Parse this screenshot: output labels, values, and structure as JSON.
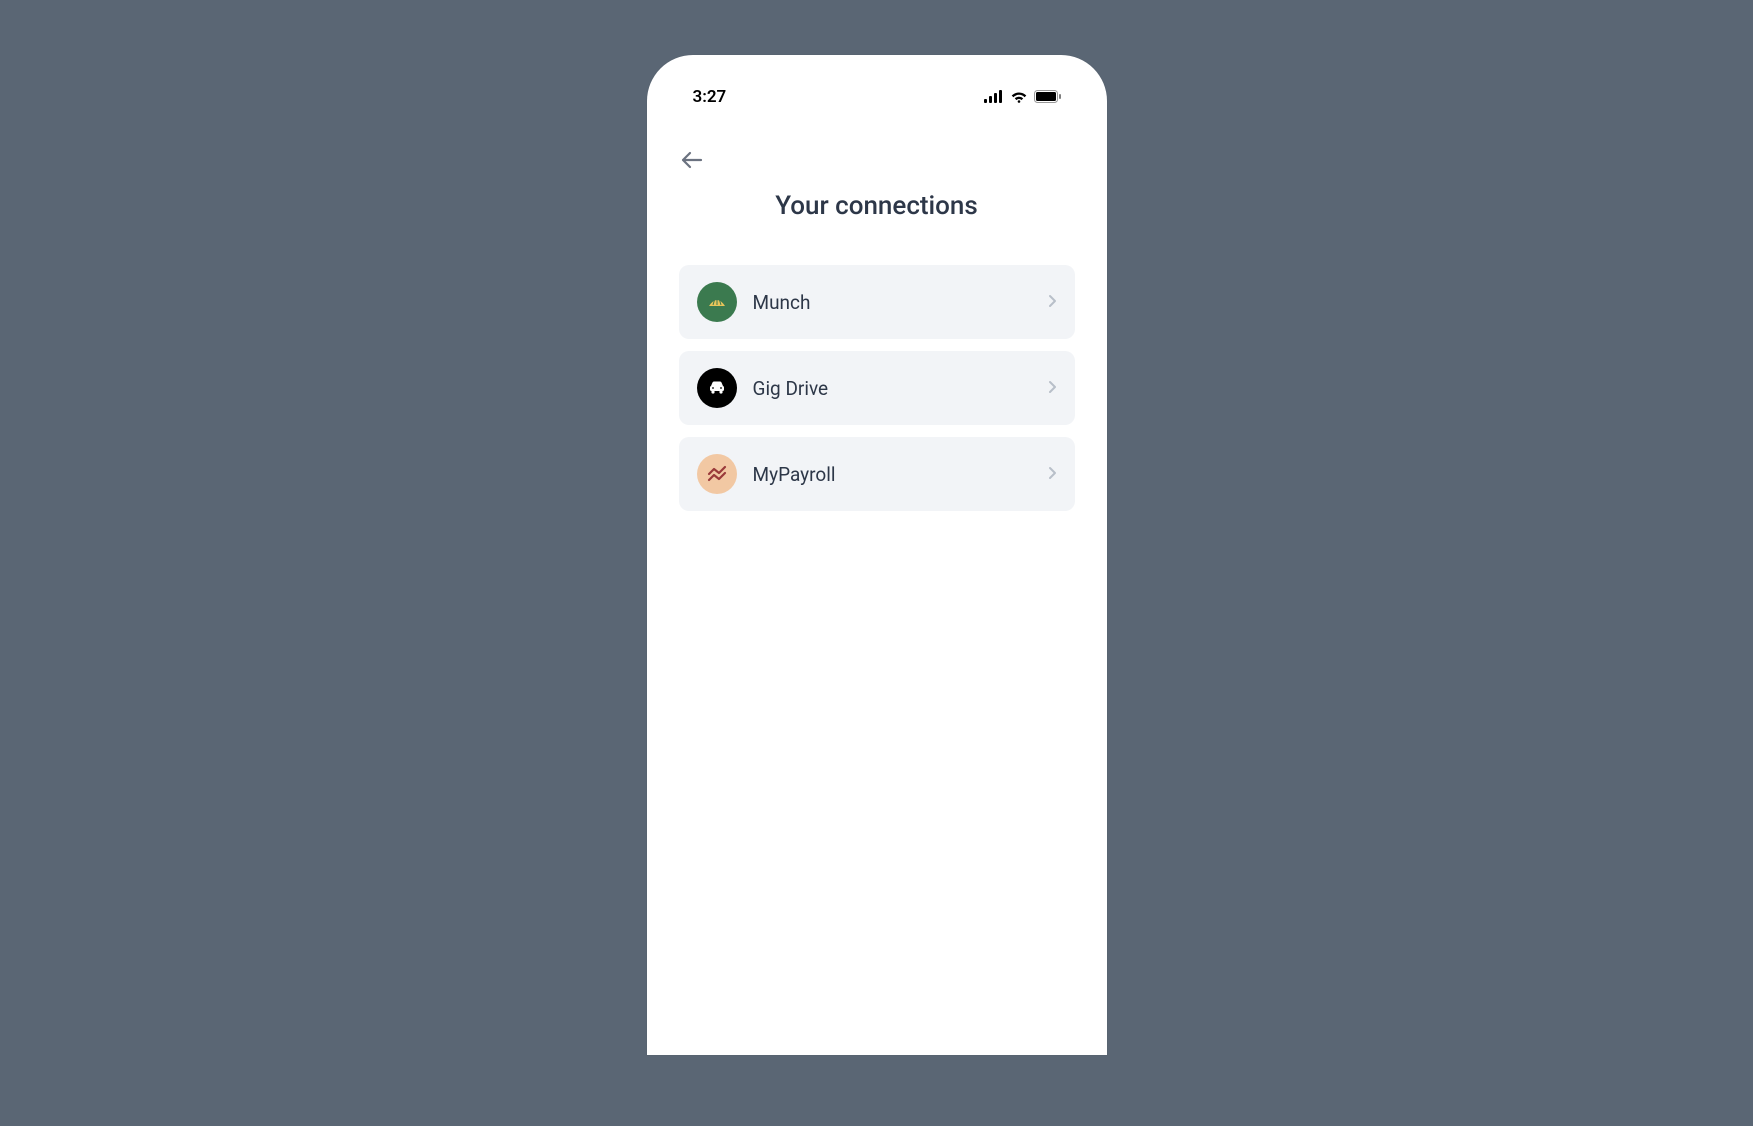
{
  "status": {
    "time": "3:27"
  },
  "header": {
    "title": "Your connections"
  },
  "connections": [
    {
      "label": "Munch",
      "icon": "munch-icon",
      "iconClass": "icon-munch"
    },
    {
      "label": "Gig Drive",
      "icon": "car-icon",
      "iconClass": "icon-gigdrive"
    },
    {
      "label": "MyPayroll",
      "icon": "chart-icon",
      "iconClass": "icon-mypayroll"
    }
  ]
}
